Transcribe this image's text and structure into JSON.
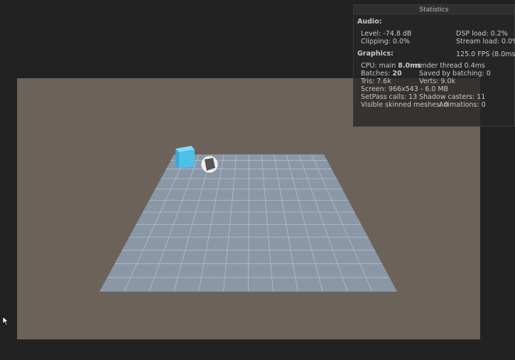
{
  "stats": {
    "title": "Statistics",
    "audio_header": "Audio:",
    "level": "Level: -74.8 dB",
    "clipping": "Clipping: 0.0%",
    "dsp_load": "DSP load: 0.2%",
    "stream_load": "Stream load: 0.0%",
    "graphics_header": "Graphics:",
    "fps": "125.0 FPS (8.0ms)",
    "cpu_prefix": "CPU: main ",
    "cpu_main": "8.0ms",
    "render_thread": "render thread 0.4ms",
    "batches_prefix": "Batches: ",
    "batches": "20",
    "saved_by_batching": "Saved by batching: 0",
    "tris": "Tris: 7.6k",
    "verts": "Verts: 9.0k",
    "screen": "Screen: 966x543 - 6.0 MB",
    "setpass": "SetPass calls: 13",
    "shadow_casters": "Shadow casters: 11",
    "skinned": "Visible skinned meshes: 0",
    "animations": "Animations: 0"
  },
  "colors": {
    "viewport_bg": "#6b6259",
    "plane": "#8a97a6",
    "cube": "#4fc0e8"
  }
}
